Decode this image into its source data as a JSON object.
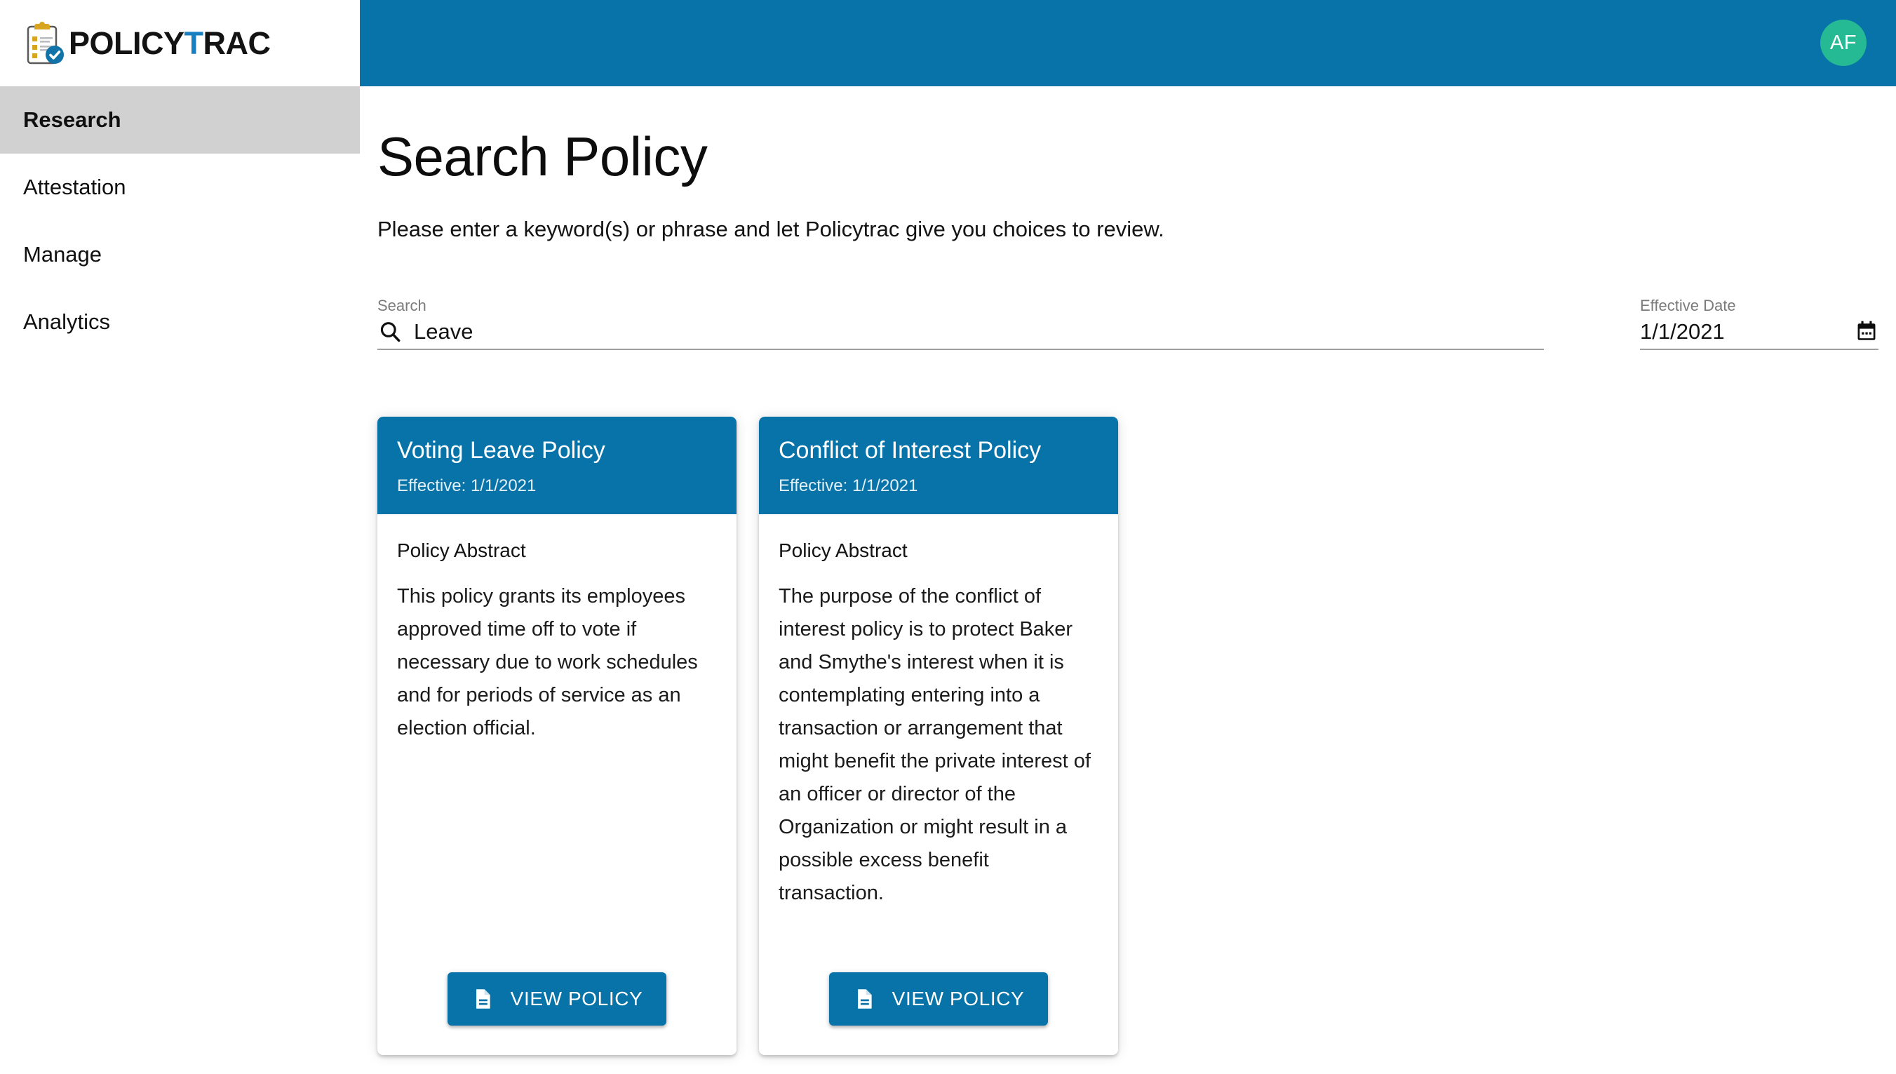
{
  "brand": {
    "name_part1": "POLICY",
    "name_accent": "T",
    "name_part2": "RAC",
    "logo_icon": "clipboard-check-icon",
    "clip_color": "#d9a520",
    "badge_color": "#1273a8"
  },
  "header": {
    "background_color": "#0873a8",
    "avatar_initials": "AF",
    "avatar_color": "#25b994"
  },
  "sidebar": {
    "items": [
      {
        "label": "Research",
        "active": true
      },
      {
        "label": "Attestation",
        "active": false
      },
      {
        "label": "Manage",
        "active": false
      },
      {
        "label": "Analytics",
        "active": false
      }
    ],
    "active_background": "#d1d1d1"
  },
  "main": {
    "title": "Search Policy",
    "subtitle": "Please enter a keyword(s) or phrase and let Policytrac give you choices to review."
  },
  "search": {
    "label": "Search",
    "value": "Leave",
    "placeholder": "Search",
    "icon": "search-icon"
  },
  "effective_date": {
    "label": "Effective Date",
    "value": "1/1/2021",
    "placeholder": "mm/dd/yyyy",
    "icon": "calendar-icon"
  },
  "cards": [
    {
      "title": "Voting Leave Policy",
      "effective": "Effective: 1/1/2021",
      "abstract_label": "Policy Abstract",
      "abstract": "This policy grants its employees approved time off to vote if necessary due to work schedules and for periods of service as an election official.",
      "button_label": "VIEW POLICY",
      "button_icon": "document-icon",
      "accent_color": "#0873a8"
    },
    {
      "title": "Conflict of Interest Policy",
      "effective": "Effective: 1/1/2021",
      "abstract_label": "Policy Abstract",
      "abstract": "The purpose of the conflict of interest policy is to protect Baker and Smythe's interest when it is contemplating entering into a transaction or arrangement that might benefit the private interest of an officer or director of the Organization or might result in a possible excess benefit transaction.",
      "button_label": "VIEW POLICY",
      "button_icon": "document-icon",
      "accent_color": "#0873a8"
    }
  ]
}
